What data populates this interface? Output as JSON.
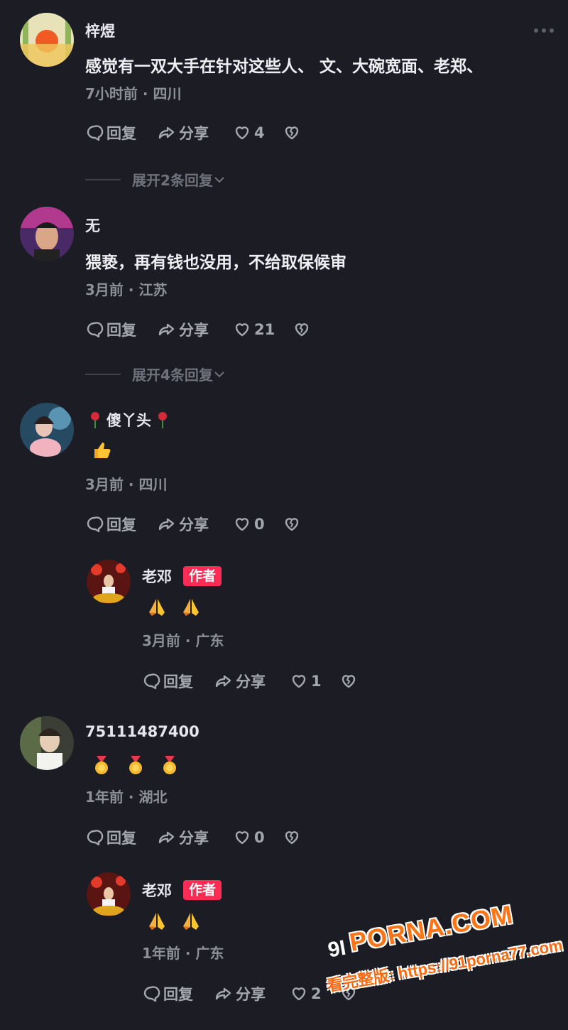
{
  "action_labels": {
    "reply": "回复",
    "share": "分享"
  },
  "comments": [
    {
      "username": "梓煜",
      "text": "感觉有一双大手在针对这些人、 文、大碗宽面、老郑、",
      "meta": "7小时前 · 四川",
      "likes": "4",
      "expand": "展开2条回复"
    },
    {
      "username": "无",
      "text": "猥亵，再有钱也没用，不给取保候审",
      "meta": "3月前 · 江苏",
      "likes": "21",
      "expand": "展开4条回复"
    },
    {
      "username": "傻丫头",
      "emojis": [
        "thumbs-up"
      ],
      "meta": "3月前 · 四川",
      "likes": "0"
    },
    {
      "username": "老邓",
      "badge": "作者",
      "emojis": [
        "folded-hands",
        "folded-hands"
      ],
      "meta": "3月前 · 广东",
      "likes": "1"
    },
    {
      "username": "75111487400",
      "emojis": [
        "medal",
        "medal",
        "medal"
      ],
      "meta": "1年前 · 湖北",
      "likes": "0"
    },
    {
      "username": "老邓",
      "badge": "作者",
      "emojis": [
        "folded-hands",
        "folded-hands"
      ],
      "meta": "1年前 · 广东",
      "likes": "2"
    }
  ],
  "watermark": {
    "logo": "9I",
    "brand": "PORNA.COM",
    "url": "看完整版: https://91porna77.com"
  },
  "colors": {
    "background": "#1c1d24",
    "author_badge": "#fe2c55",
    "meta": "#8d8f99"
  }
}
